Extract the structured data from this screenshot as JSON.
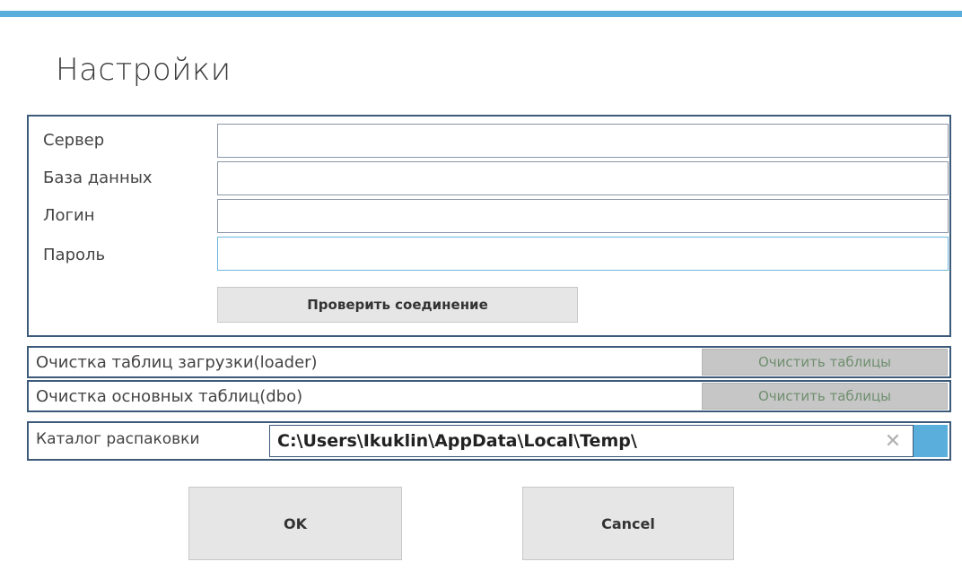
{
  "dialog": {
    "title": "Настройки"
  },
  "connection": {
    "fields": [
      {
        "label": "Сервер",
        "value": ""
      },
      {
        "label": "База данных",
        "value": ""
      },
      {
        "label": "Логин",
        "value": ""
      },
      {
        "label": "Пароль",
        "value": ""
      }
    ],
    "test_button_label": "Проверить соединение"
  },
  "cleanup": [
    {
      "label": "Очистка таблиц загрузки(loader)",
      "button_label": "Очистить таблицы"
    },
    {
      "label": "Очистка основных таблиц(dbo)",
      "button_label": "Очистить таблицы"
    }
  ],
  "unpack": {
    "label": "Каталог распаковки",
    "path": "C:\\Users\\Ikuklin\\AppData\\Local\\Temp\\",
    "clear_icon": "close-icon",
    "browse_icon": "folder-browse-icon"
  },
  "footer": {
    "ok_label": "OK",
    "cancel_label": "Cancel"
  },
  "colors": {
    "accent": "#5aaedb",
    "border": "#3c5a7a",
    "button_bg": "#e6e6e6",
    "disabled_button_bg": "#c6c6c6",
    "disabled_button_text": "#6f8f6f"
  }
}
